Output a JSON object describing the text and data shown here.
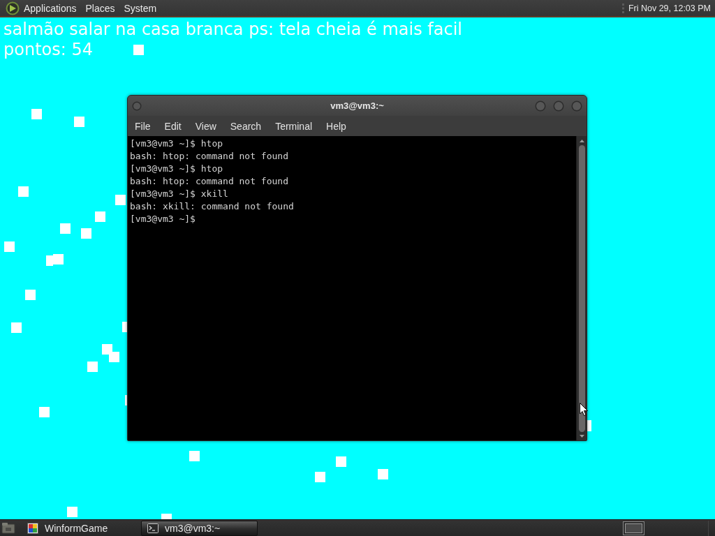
{
  "top_panel": {
    "menus": [
      "Applications",
      "Places",
      "System"
    ],
    "clock": "Fri Nov 29, 12:03 PM"
  },
  "game": {
    "title": "salmão salar na casa branca ps: tela cheia é mais facil",
    "score": "pontos: 54"
  },
  "terminal_window": {
    "title": "vm3@vm3:~",
    "menu": [
      "File",
      "Edit",
      "View",
      "Search",
      "Terminal",
      "Help"
    ],
    "lines": [
      "[vm3@vm3 ~]$ htop",
      "bash: htop: command not found",
      "[vm3@vm3 ~]$ htop",
      "bash: htop: command not found",
      "[vm3@vm3 ~]$ xkill",
      "bash: xkill: command not found",
      "[vm3@vm3 ~]$"
    ]
  },
  "taskbar": {
    "tasks": [
      {
        "label": "WinformGame",
        "kind": "app",
        "selected": false
      },
      {
        "label": "vm3@vm3:~",
        "kind": "terminal",
        "selected": true
      }
    ]
  }
}
